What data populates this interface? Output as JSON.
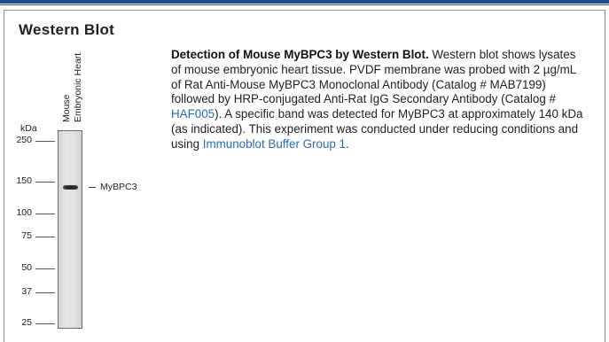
{
  "section_title": "Western Blot",
  "lane_labels": [
    "Mouse",
    "Embryonic Heart"
  ],
  "kda_label": "kDa",
  "markers": [
    {
      "label": "250",
      "kda": 250
    },
    {
      "label": "150",
      "kda": 150
    },
    {
      "label": "100",
      "kda": 100
    },
    {
      "label": "75",
      "kda": 75
    },
    {
      "label": "50",
      "kda": 50
    },
    {
      "label": "37",
      "kda": 37
    },
    {
      "label": "25",
      "kda": 25
    }
  ],
  "band": {
    "label": "MyBPC3",
    "kda": 140
  },
  "description": {
    "title": "Detection of Mouse MyBPC3 by Western Blot.",
    "text1": " Western blot shows lysates of mouse embryonic heart tissue. PVDF membrane was probed with 2 µg/mL of Rat Anti-Mouse MyBPC3 Monoclonal Antibody (Catalog # MAB7199) followed by HRP-conjugated Anti-Rat IgG Secondary Antibody (Catalog # ",
    "link1": "HAF005",
    "text2": "). A specific band was detected for MyBPC3 at approximately 140 kDa (as indicated). This experiment was conducted under reducing conditions and using ",
    "link2": "Immunoblot Buffer Group 1",
    "text3": "."
  },
  "colors": {
    "accent": "#1f4e8c",
    "link": "#2a6db5"
  }
}
